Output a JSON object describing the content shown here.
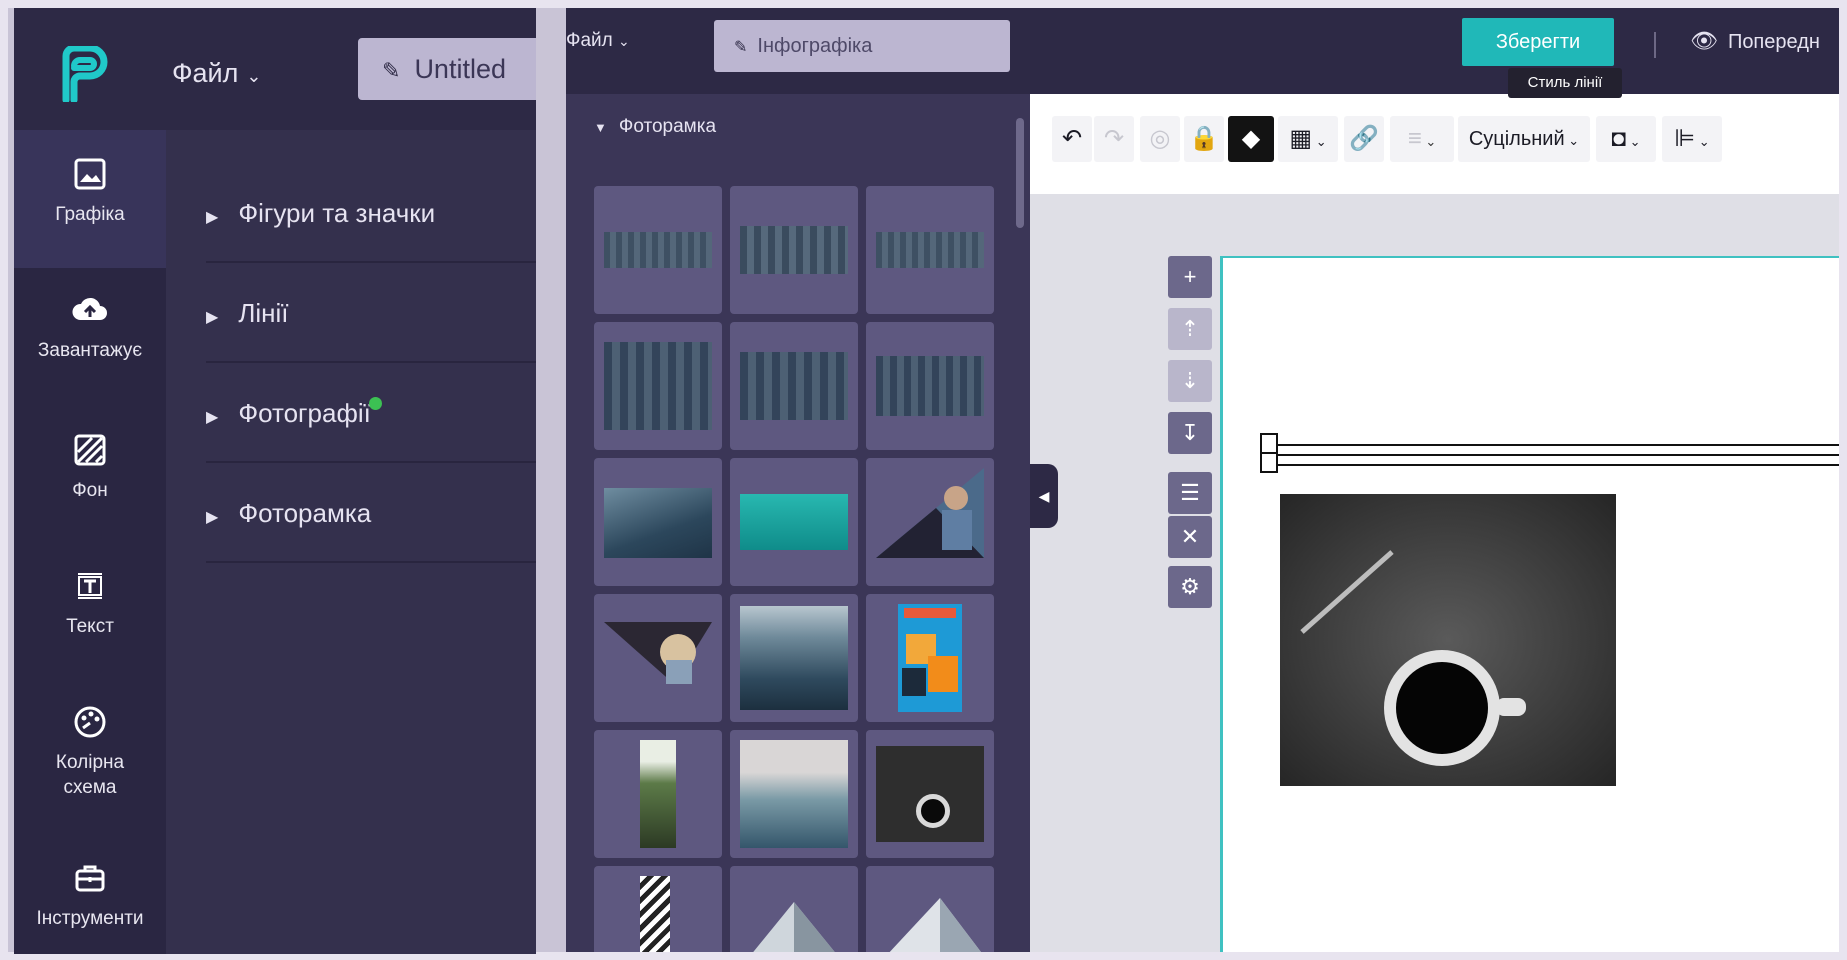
{
  "left_app": {
    "menu_file": "Файл",
    "doc_title": "Untitled",
    "nav": [
      {
        "label": "Графіка",
        "icon": "image-icon"
      },
      {
        "label": "Завантажує",
        "icon": "cloud-upload-icon"
      },
      {
        "label": "Фон",
        "icon": "background-pattern-icon"
      },
      {
        "label": "Текст",
        "icon": "text-box-icon"
      },
      {
        "label": "Колірна схема",
        "icon": "palette-icon"
      },
      {
        "label": "Інструменти",
        "icon": "toolbox-icon"
      }
    ],
    "categories": [
      {
        "label": "Фігури та значки"
      },
      {
        "label": "Лінії"
      },
      {
        "label": "Фотографії",
        "badge_color": "#3cc153"
      },
      {
        "label": "Фоторамка"
      }
    ]
  },
  "right_app": {
    "menu_file": "Файл",
    "doc_title": "Інфографіка",
    "save_label": "Зберегти",
    "tooltip": "Стиль лінії",
    "preview_label": "Попередн",
    "panel_title": "Фоторамка",
    "toolbar": {
      "line_style": "Суцільний"
    },
    "accent": "#20b8b8"
  },
  "colors": {
    "sidebar_dark": "#2a2642",
    "panel": "#3b3657",
    "tile": "#5e5880"
  }
}
